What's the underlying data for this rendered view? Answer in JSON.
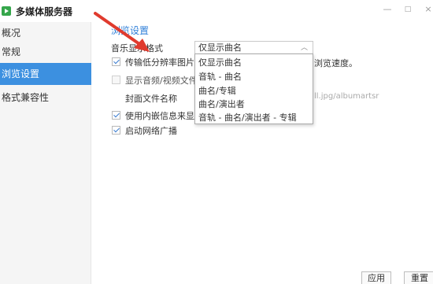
{
  "window": {
    "title": "多媒体服务器",
    "min_icon": "minimize-icon",
    "max_icon": "maximize-icon",
    "close_icon": "close-icon"
  },
  "sidebar": {
    "items": [
      {
        "label": "概况",
        "active": false
      },
      {
        "label": "常规",
        "active": false
      },
      {
        "label": "浏览设置",
        "active": true
      },
      {
        "label": "格式兼容性",
        "active": false
      }
    ]
  },
  "main": {
    "section_title": "浏览设置",
    "music_format_label": "音乐显示格式",
    "music_format_value": "仅显示曲名",
    "dropdown_options": [
      "仅显示曲名",
      "音轨 - 曲名",
      "曲名/专辑",
      "曲名/演出者",
      "音轨 - 曲名/演出者 - 专辑"
    ],
    "low_res_label": "传输低分辨率图片",
    "low_res_suffix": "浏览速度。",
    "show_av_label": "显示音频/视频文件",
    "cover_label": "封面文件名称",
    "cover_value": "ll.jpg/albumartsr",
    "embedded_label": "使用内嵌信息来显",
    "broadcast_label": "启动网络广播"
  },
  "buttons": {
    "apply": "应用",
    "reset": "重置"
  },
  "colors": {
    "accent": "#3c90e0",
    "arrow": "#e03b2e",
    "app_icon": "#35a64b"
  }
}
